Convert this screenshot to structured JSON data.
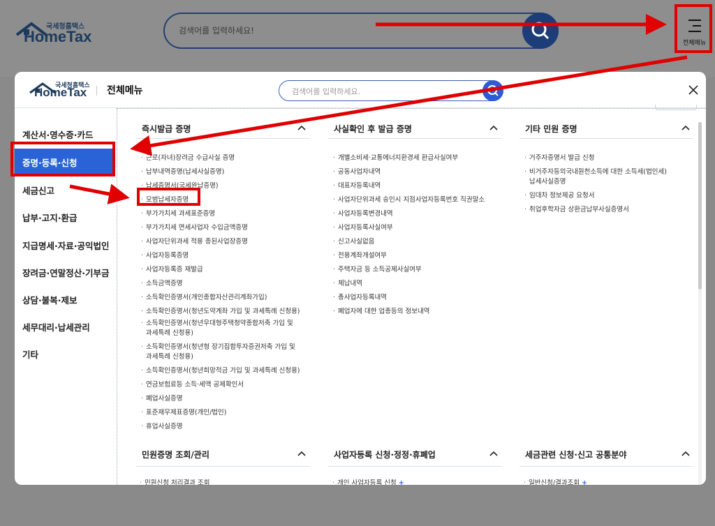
{
  "background": {
    "logo_small": "국세청홈택스",
    "logo_big": "HomeTax",
    "search_placeholder": "검색어를 입력하세요!",
    "menu_label": "전체메뉴"
  },
  "modal": {
    "logo_small": "국세청홈택스",
    "logo_big": "HomeTax",
    "title": "전체메뉴",
    "search_placeholder": "검색어를 입력하세요."
  },
  "sidebar": {
    "items": [
      {
        "label": "계산서·영수증·카드"
      },
      {
        "label": "증명·등록·신청"
      },
      {
        "label": "세금신고"
      },
      {
        "label": "납부·고지·환급"
      },
      {
        "label": "지급명세·자료·공익법인"
      },
      {
        "label": "장려금·연말정산·기부금"
      },
      {
        "label": "상담·불복·제보"
      },
      {
        "label": "세무대리·납세관리"
      },
      {
        "label": "기타"
      }
    ]
  },
  "columns": [
    {
      "heading": "즉시발급 증명",
      "items": [
        "근로(자녀)장려금 수급사실 증명",
        "납부내역증명(납세사실증명)",
        "납세증명서(국세완납증명)",
        "모범납세자증명",
        "부가가치세 과세표준증명",
        "부가가치세 면세사업자 수입금액증명",
        "사업자단위과세 적용 종된사업장증명",
        "사업자등록증명",
        "사업자등록증 재발급",
        "소득금액증명",
        "소득확인증명서(개인종합자산관리계좌가입)",
        "소득확인증명서(청년도약계좌 가입 및 과세특례 신청용)",
        "소득확인증명서(청년우대형주택청약종합저축 가입 및",
        "과세특례 신청용)",
        "소득확인증명서(청년형 장기집합투자증권저축 가입 및",
        "과세특례 신청용)",
        "소득확인증명서(청년희망적금 가입 및 과세특례 신청용)",
        "연금보험료등 소득·세액 공제확인서",
        "폐업사실증명",
        "표준재무제표증명(개인/법인)",
        "휴업사실증명"
      ]
    },
    {
      "heading": "사실확인 후 발급 증명",
      "items": [
        "개별소비세·교통에너지환경세 환급사실여부",
        "공동사업자내역",
        "대표자등록내역",
        "사업자단위과세 승인시 지점사업자등록번호 직권말소",
        "사업자등록변경내역",
        "사업자등록사실여부",
        "신고사실없음",
        "전용계좌개설여부",
        "주택자금 등 소득공제사실여부",
        "체납내역",
        "총사업자등록내역",
        "폐업자에 대한 업종등의 정보내역"
      ]
    },
    {
      "heading": "기타 민원 증명",
      "items": [
        "거주자증명서 발급 신청",
        "비거주자등의국내원천소득에 대한 소득세(법인세)",
        "납세사실증명",
        "임대차 정보제공 요청서",
        "취업후학자금 상환금납부사실증명서"
      ]
    }
  ],
  "bottom_columns": [
    {
      "heading": "민원증명 조회/관리",
      "first_item": "민원신청 처리결과 조회"
    },
    {
      "heading": "사업자등록 신청·정정·휴폐업",
      "first_item": "개인 사업자등록 신청",
      "plus": "+"
    },
    {
      "heading": "세금관련 신청·신고 공통분야",
      "first_item": "일반신청/결과조회",
      "plus": "+"
    }
  ],
  "annotation_colors": {
    "red": "#e00000",
    "accent_blue": "#2a63d6",
    "navy": "#1c3d77"
  }
}
